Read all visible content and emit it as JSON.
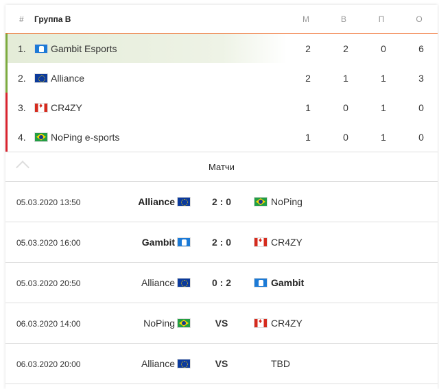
{
  "table": {
    "hash": "#",
    "group": "Группа B",
    "columns": [
      "М",
      "В",
      "П",
      "О"
    ],
    "rows": [
      {
        "pos": "1.",
        "flag": "gambit",
        "name": "Gambit Esports",
        "stats": [
          "2",
          "2",
          "0",
          "6"
        ]
      },
      {
        "pos": "2.",
        "flag": "eu",
        "name": "Alliance",
        "stats": [
          "2",
          "1",
          "1",
          "3"
        ]
      },
      {
        "pos": "3.",
        "flag": "ca",
        "name": "CR4ZY",
        "stats": [
          "1",
          "0",
          "1",
          "0"
        ]
      },
      {
        "pos": "4.",
        "flag": "br",
        "name": "NoPing e-sports",
        "stats": [
          "1",
          "0",
          "1",
          "0"
        ]
      }
    ]
  },
  "matches": {
    "title": "Матчи",
    "items": [
      {
        "date": "05.03.2020 13:50",
        "home": "Alliance",
        "home_flag": "eu",
        "score": "2 : 0",
        "away": "NoPing",
        "away_flag": "br",
        "winner": "home"
      },
      {
        "date": "05.03.2020 16:00",
        "home": "Gambit",
        "home_flag": "gambit",
        "score": "2 : 0",
        "away": "CR4ZY",
        "away_flag": "ca",
        "winner": "home"
      },
      {
        "date": "05.03.2020 20:50",
        "home": "Alliance",
        "home_flag": "eu",
        "score": "0 : 2",
        "away": "Gambit",
        "away_flag": "gambit",
        "winner": "away"
      },
      {
        "date": "06.03.2020 14:00",
        "home": "NoPing",
        "home_flag": "br",
        "score": "VS",
        "away": "CR4ZY",
        "away_flag": "ca",
        "winner": ""
      },
      {
        "date": "06.03.2020 20:00",
        "home": "Alliance",
        "home_flag": "eu",
        "score": "VS",
        "away": "TBD",
        "away_flag": "",
        "winner": ""
      }
    ]
  },
  "colors": {
    "qualified": "#7cab3f",
    "eliminated": "#d9232e",
    "accent": "#f07030"
  }
}
